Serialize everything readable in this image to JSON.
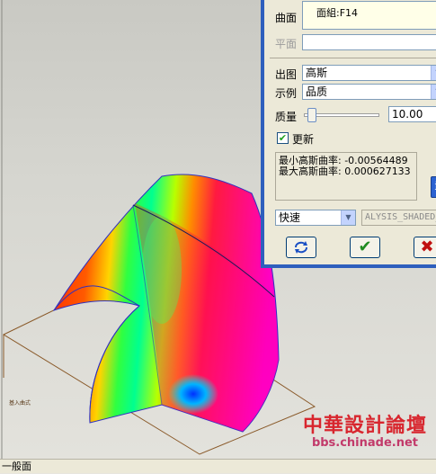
{
  "dialog": {
    "surface_label": "曲面",
    "surface_value": "面組:F14",
    "plane_label": "平面",
    "output_label": "出图",
    "output_value": "高斯",
    "display_label": "示例",
    "display_value": "品质",
    "quality_label": "质量",
    "quality_value": "10.00",
    "quality_level": 0.05,
    "update_label": "更新",
    "update_checked": true,
    "result_line1": "最小高斯曲率: -0.00564489",
    "result_line2": "最大高斯曲率: 0.000627133",
    "mode_value": "快速",
    "analysis_name": "ALYSIS_SHADED_",
    "colors": {
      "ok_green": "#1f8a1f",
      "cancel_red": "#c01010",
      "title_blue": "#2e5fbd"
    }
  },
  "viewport": {
    "plane_tag": "基入曲式"
  },
  "watermark": {
    "title": "中華設計論壇",
    "url": "bbs.chinade.net"
  },
  "statusbar": {
    "text": "一般面"
  }
}
